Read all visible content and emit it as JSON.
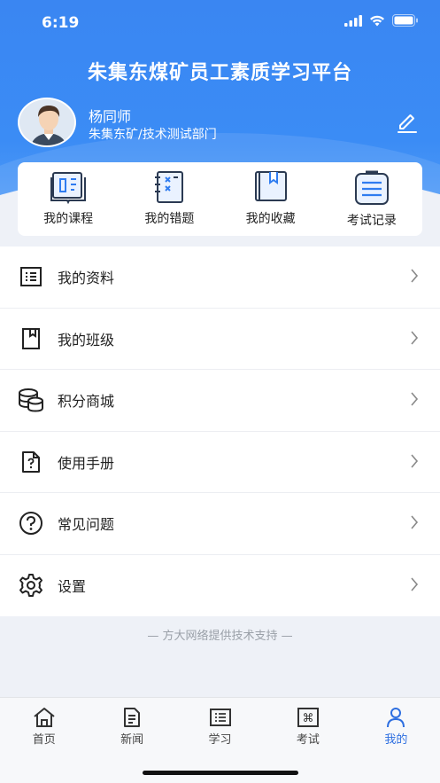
{
  "status": {
    "time": "6:19"
  },
  "app": {
    "title": "朱集东煤矿员工素质学习平台"
  },
  "profile": {
    "name": "杨同师",
    "department": "朱集东矿/技术测试部门"
  },
  "quick_links": [
    {
      "label": "我的课程",
      "icon": "book-open-icon"
    },
    {
      "label": "我的错题",
      "icon": "notebook-x-icon"
    },
    {
      "label": "我的收藏",
      "icon": "bookmark-book-icon"
    },
    {
      "label": "考试记录",
      "icon": "clipboard-list-icon"
    }
  ],
  "menu": [
    {
      "label": "我的资料",
      "icon": "list-doc-icon"
    },
    {
      "label": "我的班级",
      "icon": "bookmark-icon"
    },
    {
      "label": "积分商城",
      "icon": "coins-icon"
    },
    {
      "label": "使用手册",
      "icon": "help-doc-icon"
    },
    {
      "label": "常见问题",
      "icon": "question-circle-icon"
    },
    {
      "label": "设置",
      "icon": "gear-icon"
    }
  ],
  "footer_note": "— 方大网络提供技术支持 —",
  "tabs": [
    {
      "label": "首页",
      "icon": "home-icon"
    },
    {
      "label": "新闻",
      "icon": "news-icon"
    },
    {
      "label": "学习",
      "icon": "study-icon"
    },
    {
      "label": "考试",
      "icon": "exam-icon"
    },
    {
      "label": "我的",
      "icon": "person-icon",
      "active": true
    }
  ],
  "colors": {
    "primary": "#3a86f2",
    "active_tab": "#2e6fe0"
  }
}
